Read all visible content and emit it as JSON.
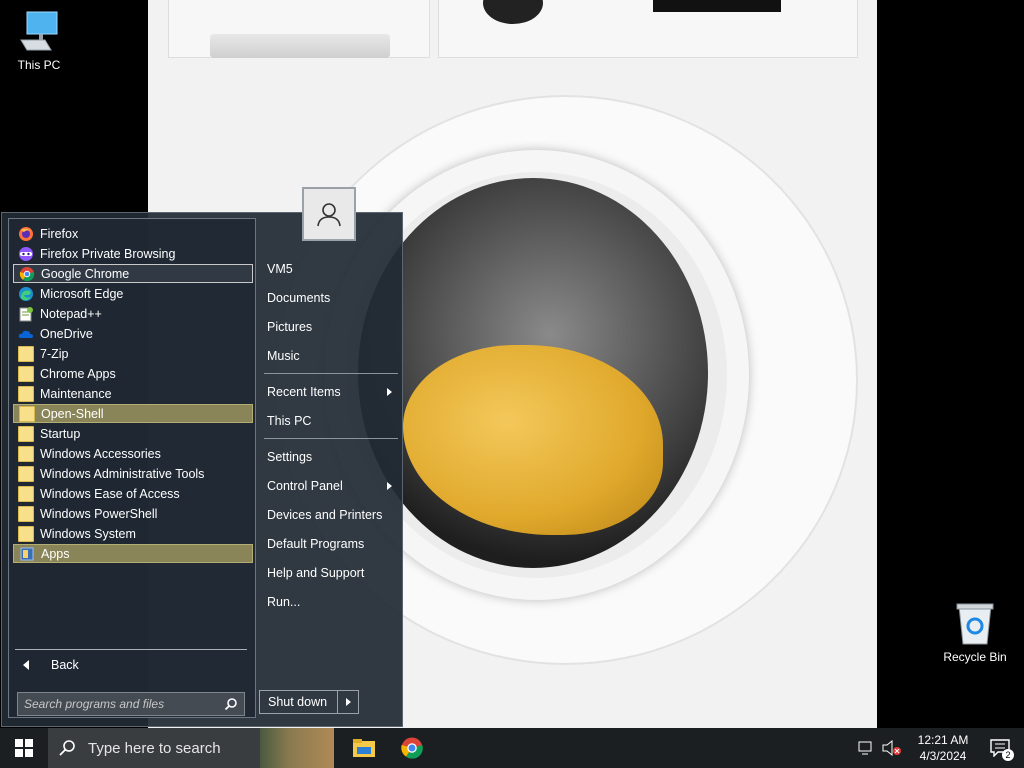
{
  "desktop": {
    "icons": [
      {
        "label": "This PC"
      },
      {
        "label": "Recycle Bin"
      }
    ]
  },
  "start_menu": {
    "programs": [
      {
        "label": "Firefox",
        "icon": "firefox-icon"
      },
      {
        "label": "Firefox Private Browsing",
        "icon": "firefox-private-icon"
      },
      {
        "label": "Google Chrome",
        "icon": "chrome-icon"
      },
      {
        "label": "Microsoft Edge",
        "icon": "edge-icon"
      },
      {
        "label": "Notepad++",
        "icon": "notepadpp-icon"
      },
      {
        "label": "OneDrive",
        "icon": "onedrive-icon"
      },
      {
        "label": "7-Zip",
        "icon": "folder-icon"
      },
      {
        "label": "Chrome Apps",
        "icon": "folder-icon"
      },
      {
        "label": "Maintenance",
        "icon": "folder-icon"
      },
      {
        "label": "Open-Shell",
        "icon": "folder-icon"
      },
      {
        "label": "Startup",
        "icon": "folder-icon"
      },
      {
        "label": "Windows Accessories",
        "icon": "folder-icon"
      },
      {
        "label": "Windows Administrative Tools",
        "icon": "folder-icon"
      },
      {
        "label": "Windows Ease of Access",
        "icon": "folder-icon"
      },
      {
        "label": "Windows PowerShell",
        "icon": "folder-icon"
      },
      {
        "label": "Windows System",
        "icon": "folder-icon"
      },
      {
        "label": "Apps",
        "icon": "apps-icon"
      }
    ],
    "back_label": "Back",
    "search_placeholder": "Search programs and files",
    "right_items": [
      {
        "label": "VM5"
      },
      {
        "label": "Documents"
      },
      {
        "label": "Pictures"
      },
      {
        "label": "Music"
      },
      {
        "label": "Recent Items",
        "submenu": true
      },
      {
        "label": "This PC"
      },
      {
        "label": "Settings"
      },
      {
        "label": "Control Panel",
        "submenu": true
      },
      {
        "label": "Devices and Printers"
      },
      {
        "label": "Default Programs"
      },
      {
        "label": "Help and Support"
      },
      {
        "label": "Run..."
      }
    ],
    "shutdown_label": "Shut down"
  },
  "taskbar": {
    "search_text": "Type here to search",
    "time": "12:21 AM",
    "date": "4/3/2024",
    "notification_count": "2"
  },
  "colors": {
    "menu_bg": "#212a34",
    "highlight_gold": "#8a8558",
    "taskbar_bg": "#1c1f22"
  }
}
